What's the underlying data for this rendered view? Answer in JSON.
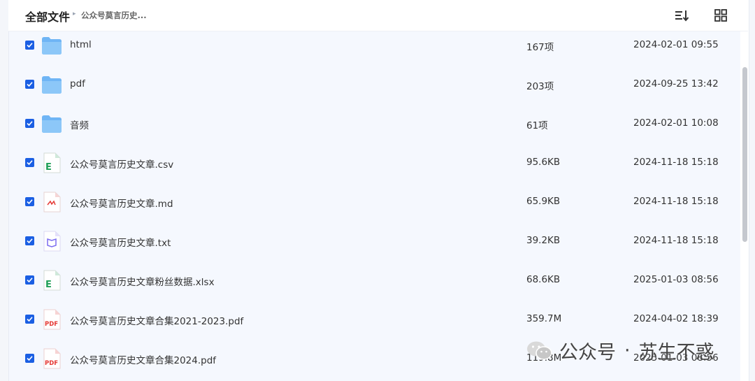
{
  "header": {
    "root_label": "全部文件",
    "current_folder": "公众号莫言历史...",
    "sort_icon": "sort-icon",
    "grid_icon": "grid-view-icon"
  },
  "colors": {
    "accent": "#1b5fe3",
    "list_bg": "#f5f8fe",
    "folder": "#6fb5f5",
    "excel": "#1e9f57",
    "pdf": "#e53935",
    "md": "#e53935",
    "txt": "#7b6cf0"
  },
  "files": [
    {
      "name": "html",
      "size": "167项",
      "date": "2024-02-01 09:55",
      "type": "folder",
      "checked": true
    },
    {
      "name": "pdf",
      "size": "203项",
      "date": "2024-09-25 13:42",
      "type": "folder",
      "checked": true
    },
    {
      "name": "音频",
      "size": "61项",
      "date": "2024-02-01 10:08",
      "type": "folder",
      "checked": true
    },
    {
      "name": "公众号莫言历史文章.csv",
      "size": "95.6KB",
      "date": "2024-11-18 15:18",
      "type": "excel",
      "checked": true
    },
    {
      "name": "公众号莫言历史文章.md",
      "size": "65.9KB",
      "date": "2024-11-18 15:18",
      "type": "md",
      "checked": true
    },
    {
      "name": "公众号莫言历史文章.txt",
      "size": "39.2KB",
      "date": "2024-11-18 15:18",
      "type": "txt",
      "checked": true
    },
    {
      "name": "公众号莫言历史文章粉丝数据.xlsx",
      "size": "68.6KB",
      "date": "2025-01-03 08:56",
      "type": "excel",
      "checked": true
    },
    {
      "name": "公众号莫言历史文章合集2021-2023.pdf",
      "size": "359.7M",
      "date": "2024-04-02 18:39",
      "type": "pdf",
      "checked": true
    },
    {
      "name": "公众号莫言历史文章合集2024.pdf",
      "size": "119.8M",
      "date": "2025-01-03 08:56",
      "type": "pdf",
      "checked": true
    }
  ],
  "watermark": {
    "prefix": "公众号",
    "separator": "·",
    "name": "苏生不惑"
  }
}
